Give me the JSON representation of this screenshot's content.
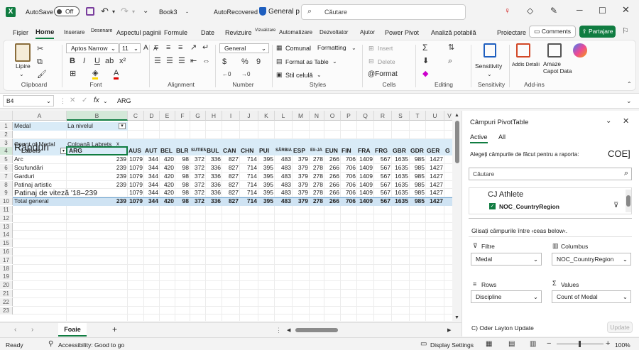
{
  "titlebar": {
    "autosave_label": "AutoSave",
    "toggle_label": "Off",
    "filename": "Book3",
    "status": "AutoRecovered",
    "sensitivity": "General p",
    "search_placeholder": "Căutare"
  },
  "ribbon_tabs": [
    "Fișier",
    "Home",
    "Inserare",
    "Desenare",
    "Aspectul paginii",
    "Formule",
    "Date",
    "Revizuire",
    "Vizualizare",
    "Automatizare",
    "Dezvoltator",
    "Ajutor",
    "Power Pivot",
    "Analiză potabilă",
    "Proiectare"
  ],
  "ribbon_active": "Home",
  "comments_label": "Comments",
  "share_label": "Partajare",
  "ribbon": {
    "paste_label": "Lipire",
    "clipboard_group": "Clipboard",
    "font_name": "Aptos Narrow",
    "font_size": "11",
    "font_group": "Font",
    "alignment_group": "Alignment",
    "number_format": "General",
    "number_group": "Number",
    "cond_format": "Comunal",
    "formatting": "Formatting",
    "format_table": "Format as Table",
    "cell_styles": "Stil celulă",
    "styles_group": "Styles",
    "insert_label": "Insert",
    "delete_label": "Delete",
    "format_label": "@Format",
    "cells_group": "Cells",
    "editing_group": "Editing",
    "sensitivity_label": "Sensitivity",
    "sensitivity_group": "Sensitivity",
    "addins_label": "Addis Detalii",
    "amaze_label": "Amaze Capot Data",
    "addins_group": "Add-ins"
  },
  "formula_bar": {
    "name_box": "B4",
    "fx": "fx",
    "value": "ARG"
  },
  "columns": [
    "A",
    "B",
    "C",
    "D",
    "E",
    "F",
    "G",
    "H",
    "I",
    "J",
    "K",
    "L",
    "M",
    "N",
    "O",
    "P",
    "Q",
    "R",
    "S",
    "T",
    "U",
    "V"
  ],
  "row_numbers": [
    "1",
    "2",
    "3",
    "4",
    "5",
    "6",
    "7",
    "8",
    "9",
    "10",
    "11",
    "12",
    "13",
    "14",
    "15",
    "16",
    "17",
    "18",
    "19",
    "20",
    "21",
    "22",
    "23"
  ],
  "pivot": {
    "filter_label": "Medal",
    "filter_value": "La nivelul",
    "count_label": "Count of Medal",
    "column_labels": "Coloană Labrets",
    "row_labels_overlay": "Rânduri",
    "row_labels": "Labels",
    "headers": [
      "ARG",
      "AUS",
      "AUT",
      "BEL",
      "BLR",
      "SUTIEN",
      "BUL",
      "CAN",
      "CHN",
      "PUI",
      "SÂRBIA",
      "ESP",
      "Eli-JA",
      "EUN",
      "FIN",
      "FRA",
      "FRG",
      "GBR",
      "GDR",
      "GER",
      "G"
    ],
    "rows": [
      {
        "label": "Arc",
        "values": [
          "239",
          "1079",
          "344",
          "420",
          "98",
          "372",
          "336",
          "827",
          "714",
          "395",
          "483",
          "379",
          "278",
          "266",
          "706",
          "1409",
          "567",
          "1635",
          "985",
          "1427"
        ]
      },
      {
        "label": "Scufundări",
        "values": [
          "239",
          "1079",
          "344",
          "420",
          "98",
          "372",
          "336",
          "827",
          "714",
          "395",
          "483",
          "379",
          "278",
          "266",
          "706",
          "1409",
          "567",
          "1635",
          "985",
          "1427"
        ]
      },
      {
        "label": "Garduri",
        "values": [
          "239",
          "1079",
          "344",
          "420",
          "98",
          "372",
          "336",
          "827",
          "714",
          "395",
          "483",
          "379",
          "278",
          "266",
          "706",
          "1409",
          "567",
          "1635",
          "985",
          "1427"
        ]
      },
      {
        "label": "Patinaj artistic",
        "values": [
          "239",
          "1079",
          "344",
          "420",
          "98",
          "372",
          "336",
          "827",
          "714",
          "395",
          "483",
          "379",
          "278",
          "266",
          "706",
          "1409",
          "567",
          "1635",
          "985",
          "1427"
        ]
      },
      {
        "label": "Patinaj de viteză '18–239",
        "values": [
          "",
          "1079",
          "344",
          "420",
          "98",
          "372",
          "336",
          "827",
          "714",
          "395",
          "483",
          "379",
          "278",
          "266",
          "706",
          "1409",
          "567",
          "1635",
          "985",
          "1427"
        ]
      }
    ],
    "total_label": "Total general",
    "total_values": [
      "239",
      "1079",
      "344",
      "420",
      "98",
      "372",
      "336",
      "827",
      "714",
      "395",
      "483",
      "379",
      "278",
      "266",
      "706",
      "1409",
      "567",
      "1635",
      "985",
      "1427"
    ]
  },
  "sheet_tab": "Foaie",
  "pane": {
    "title": "Câmpuri PivotTable",
    "tab_active": "Active",
    "tab_all": "All",
    "choose_label": "Alegeți câmpurile de făcut pentru a raporta:",
    "coe": "COE]",
    "search_placeholder": "Căutare",
    "field1": "CJ Athlete",
    "field2": "NOC_CountryRegion",
    "drag_label": "Glisați câmpurile între ‹ceas below‹.",
    "filters_label": "Filtre",
    "columns_label": "Columbus",
    "filter_item": "Medal",
    "column_item": "NOC_CountryRegion",
    "rows_label": "Rows",
    "values_label": "Values",
    "row_item": "Discipline",
    "value_item": "Count of Medal",
    "defer_label": "C) Oder Layton Update",
    "update_label": "Update"
  },
  "status": {
    "ready": "Ready",
    "accessibility": "Accessibility: Good to go",
    "display_settings": "Display Settings",
    "zoom": "100%"
  },
  "colors": {
    "accent": "#0f7b3f",
    "pivot_header": "#d9ebf7",
    "pivot_total": "#cfe3f3"
  }
}
